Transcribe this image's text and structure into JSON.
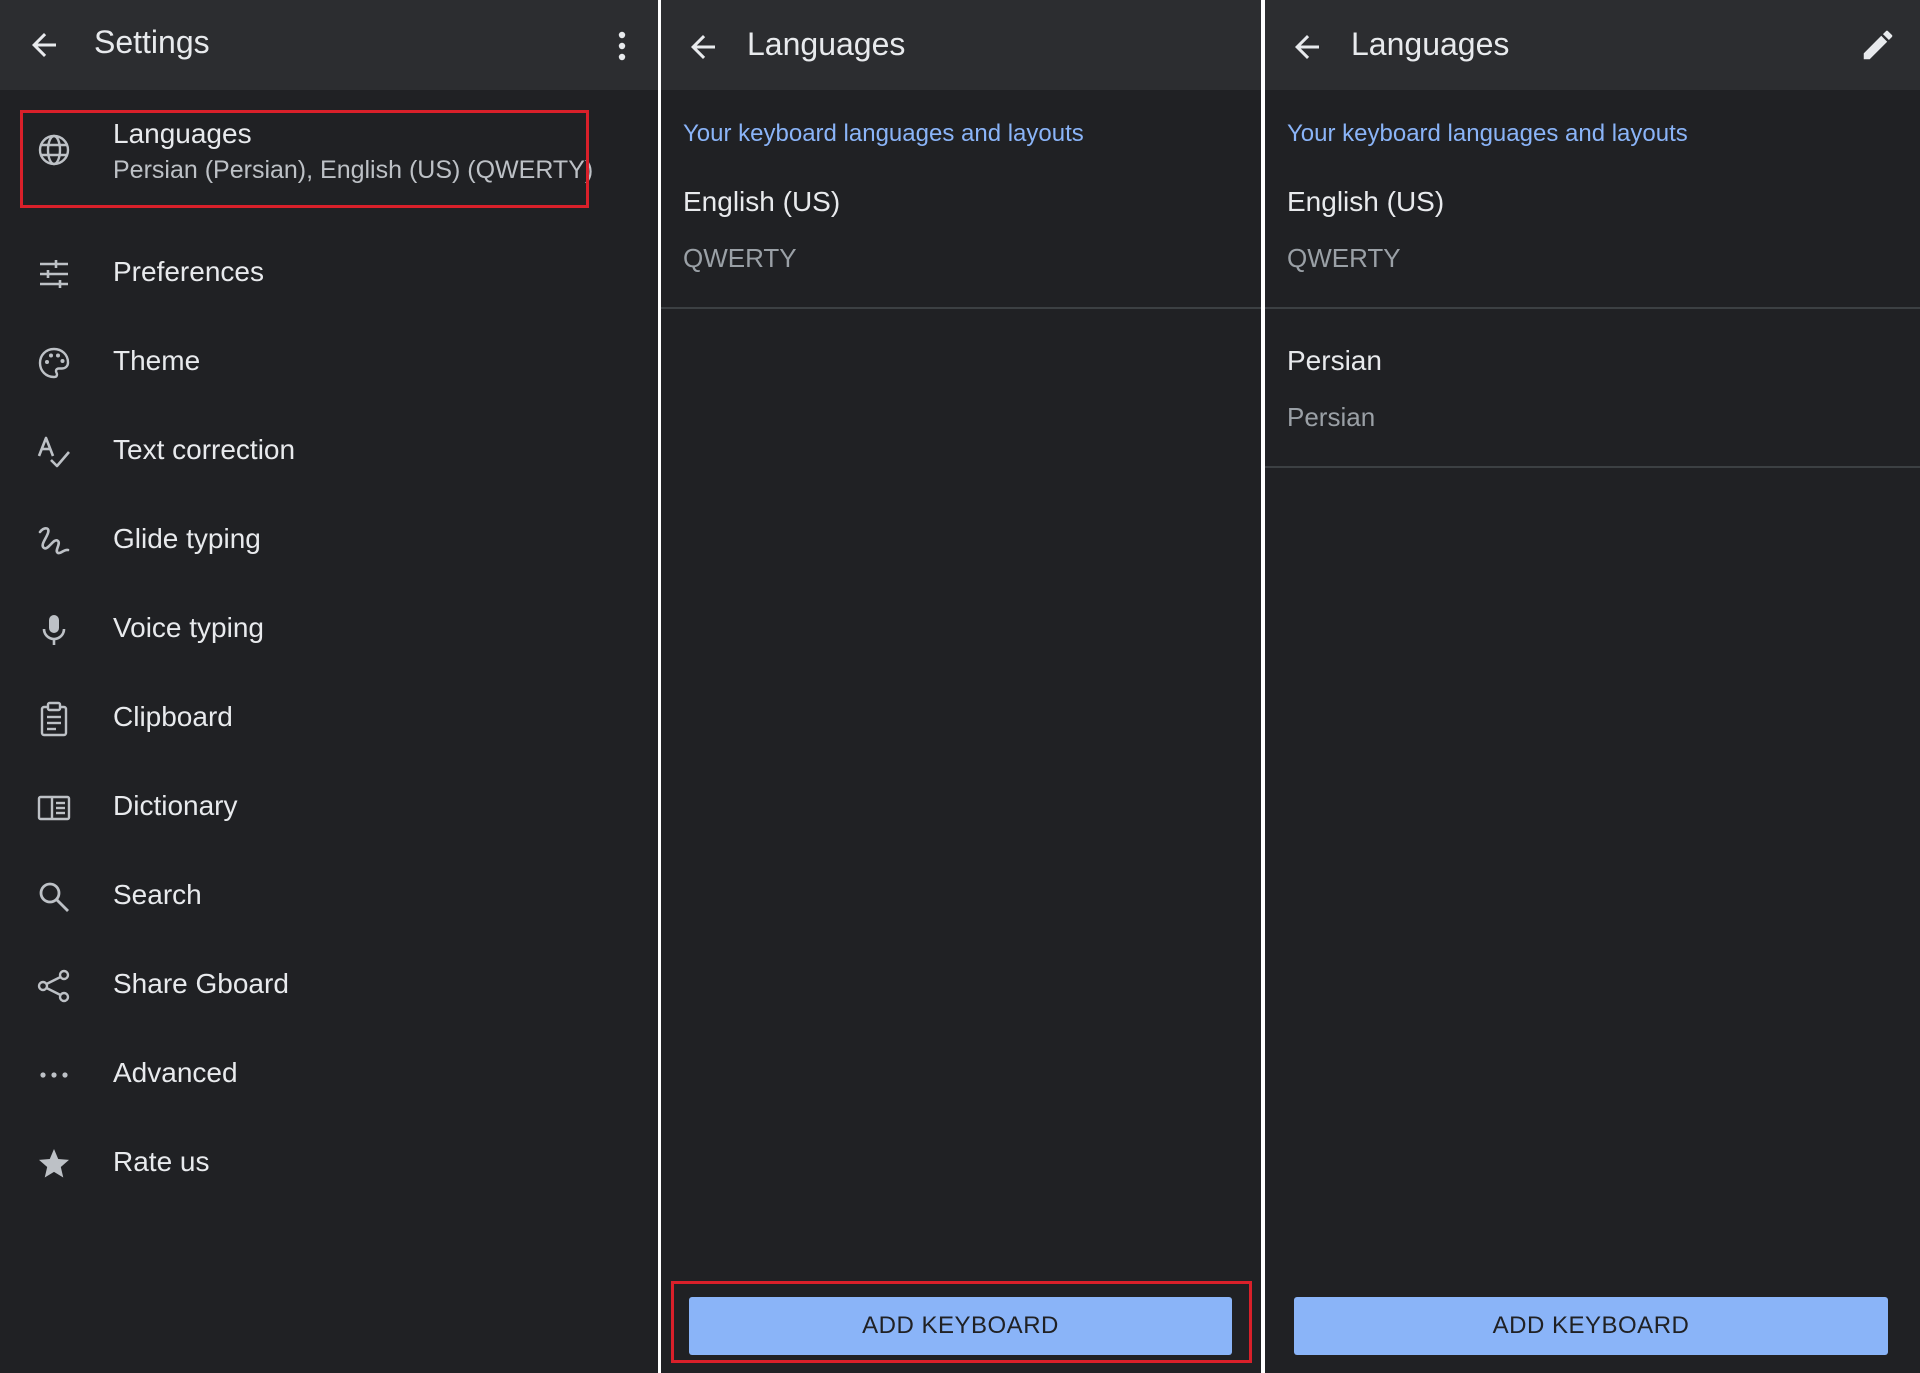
{
  "settings": {
    "title": "Settings",
    "languages": {
      "label": "Languages",
      "subtitle": "Persian (Persian), English (US) (QWERTY)"
    },
    "items": [
      {
        "label": "Preferences",
        "icon": "tune-icon"
      },
      {
        "label": "Theme",
        "icon": "palette-icon"
      },
      {
        "label": "Text correction",
        "icon": "spellcheck-icon"
      },
      {
        "label": "Glide typing",
        "icon": "gesture-icon"
      },
      {
        "label": "Voice typing",
        "icon": "mic-icon"
      },
      {
        "label": "Clipboard",
        "icon": "clipboard-icon"
      },
      {
        "label": "Dictionary",
        "icon": "book-icon"
      },
      {
        "label": "Search",
        "icon": "search-icon"
      },
      {
        "label": "Share Gboard",
        "icon": "share-icon"
      },
      {
        "label": "Advanced",
        "icon": "more-horiz-icon"
      },
      {
        "label": "Rate us",
        "icon": "star-icon"
      }
    ]
  },
  "languages_panel_1": {
    "title": "Languages",
    "section_header": "Your keyboard languages and layouts",
    "keyboards": [
      {
        "name": "English (US)",
        "layout": "QWERTY"
      }
    ],
    "add_button": "ADD KEYBOARD"
  },
  "languages_panel_2": {
    "title": "Languages",
    "section_header": "Your keyboard languages and layouts",
    "keyboards": [
      {
        "name": "English (US)",
        "layout": "QWERTY"
      },
      {
        "name": "Persian",
        "layout": "Persian"
      }
    ],
    "add_button": "ADD KEYBOARD"
  },
  "colors": {
    "background": "#202124",
    "appbar": "#2c2d30",
    "accent": "#8ab4f8",
    "highlight": "#d9202a"
  }
}
